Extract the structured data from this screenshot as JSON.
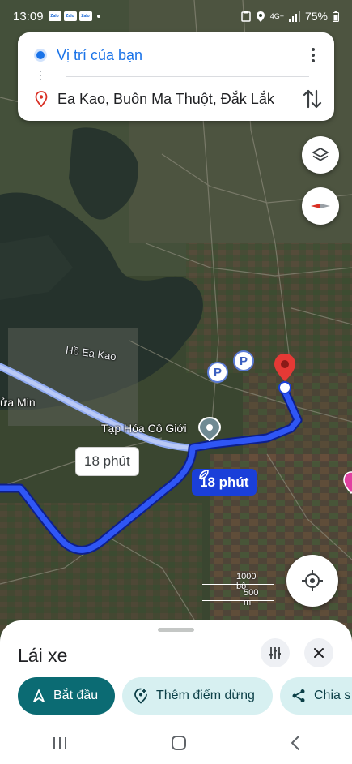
{
  "status_bar": {
    "time": "13:09",
    "notification_apps": [
      "Zalo",
      "Zalo",
      "Zalo"
    ],
    "network": "4G+",
    "battery": "75%"
  },
  "directions": {
    "origin": "Vị trí của bạn",
    "destination": "Ea Kao, Buôn Ma Thuột, Đắk Lắk"
  },
  "map": {
    "lake_label": "Hồ Ea Kao",
    "left_label": "ửa Min",
    "shop_label": "Tạp Hóa Cô Giới",
    "parking_label": "P",
    "alt_route_time": "18 phút",
    "main_route_time": "18 phút",
    "scale_feet": "1000 bộ",
    "scale_meters": "500 m"
  },
  "bottom_sheet": {
    "title": "Lái xe",
    "start_label": "Bắt đầu",
    "add_stop_label": "Thêm điểm dừng",
    "share_label": "Chia s"
  },
  "colors": {
    "route": "#1a3fd9",
    "accent": "#1a73e8",
    "start_chip": "#0b6b73",
    "chip_bg": "#d7f0f1"
  }
}
